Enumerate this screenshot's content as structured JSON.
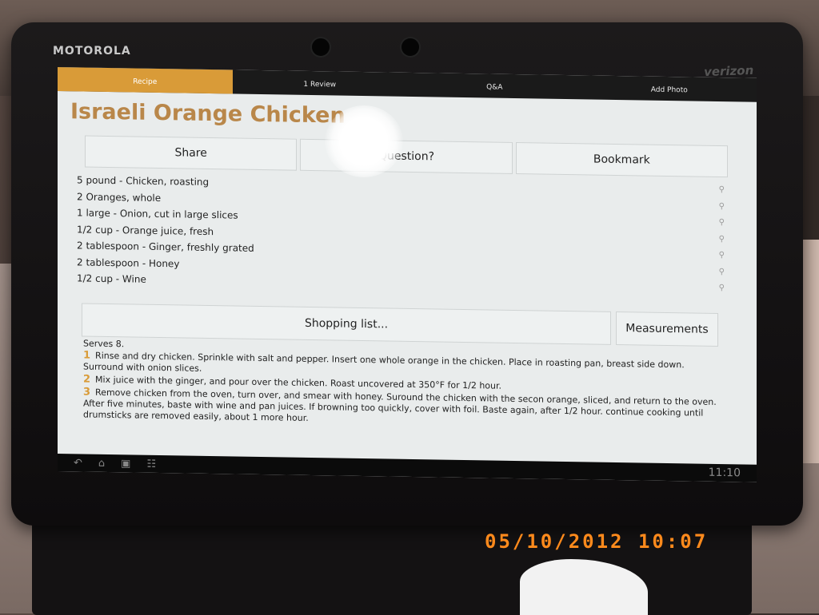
{
  "device": {
    "brand": "MOTOROLA",
    "carrier": "verizon"
  },
  "tabs": [
    {
      "label": "Recipe",
      "active": true
    },
    {
      "label": "1 Review",
      "active": false
    },
    {
      "label": "Q&A",
      "active": false
    },
    {
      "label": "Add Photo",
      "active": false
    }
  ],
  "recipe": {
    "title": "Israeli Orange Chicken",
    "actions": {
      "share": "Share",
      "question": "Question?",
      "bookmark": "Bookmark"
    },
    "ingredients": [
      "5 pound - Chicken, roasting",
      "2 Oranges, whole",
      "1 large - Onion, cut in large slices",
      "1/2 cup - Orange juice, fresh",
      "2 tablespoon - Ginger, freshly grated",
      "2 tablespoon - Honey",
      "1/2 cup - Wine"
    ],
    "shopping_list_label": "Shopping list...",
    "measurements_label": "Measurements",
    "serves": "Serves 8.",
    "steps": [
      {
        "num": "1",
        "text": "Rinse and dry chicken. Sprinkle with salt and pepper. Insert one whole orange in the chicken. Place in roasting pan, breast side down. Surround with onion slices."
      },
      {
        "num": "2",
        "text": "Mix juice with the ginger, and pour over the chicken. Roast uncovered at 350°F for 1/2 hour."
      },
      {
        "num": "3",
        "text": "Remove chicken from the oven, turn over, and smear with honey. Suround the chicken with the secon orange, sliced, and return to the oven. After five minutes, baste with wine and pan juices. If browning too quickly, cover with foil. Baste again, after 1/2 hour. continue cooking until drumsticks are removed easily, about 1 more hour."
      }
    ]
  },
  "system_bar": {
    "clock": "11:10"
  },
  "photo_timestamp": "05/10/2012  10:07",
  "colors": {
    "accent": "#d99b38",
    "title": "#b9874a",
    "timestamp": "#ff8a1c"
  }
}
